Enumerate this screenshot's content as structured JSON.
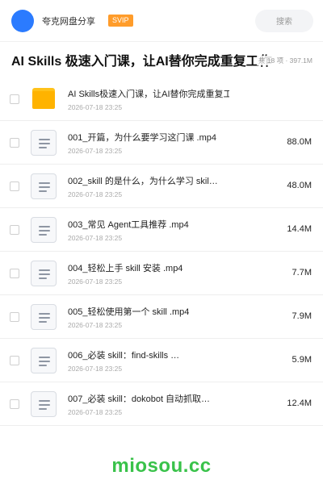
{
  "header": {
    "app_name": "夸克网盘分享",
    "badge": "SVIP",
    "search_placeholder": "搜索"
  },
  "share": {
    "title": "AI Skills 极速入门课，让AI替你完成重复工作",
    "summary": "共 18 项 · 397.1M"
  },
  "files": [
    {
      "name": "AI Skills极速入门课，让AI替你完成重复工作",
      "date": "2026-07-18 23:25",
      "size": "",
      "type": "folder"
    },
    {
      "name": "001_开篇，为什么要学习这门课 .mp4",
      "date": "2026-07-18 23:25",
      "size": "88.0M",
      "type": "file"
    },
    {
      "name": "002_skill 的是什么，为什么学习 skil…",
      "date": "2026-07-18 23:25",
      "size": "48.0M",
      "type": "file"
    },
    {
      "name": "003_常见 Agent工具推荐 .mp4",
      "date": "2026-07-18 23:25",
      "size": "14.4M",
      "type": "file"
    },
    {
      "name": "004_轻松上手 skill 安装 .mp4",
      "date": "2026-07-18 23:25",
      "size": "7.7M",
      "type": "file"
    },
    {
      "name": "005_轻松使用第一个 skill .mp4",
      "date": "2026-07-18 23:25",
      "size": "7.9M",
      "type": "file"
    },
    {
      "name": "006_必装 skill：find-skills …",
      "date": "2026-07-18 23:25",
      "size": "5.9M",
      "type": "file"
    },
    {
      "name": "007_必装 skill：dokobot 自动抓取…",
      "date": "2026-07-18 23:25",
      "size": "12.4M",
      "type": "file"
    }
  ],
  "watermark": "miosou.cc",
  "colors": {
    "accent": "#2b7bff",
    "badge": "#ff9c2a",
    "folder": "#ffb300",
    "watermark": "#39c24a"
  }
}
